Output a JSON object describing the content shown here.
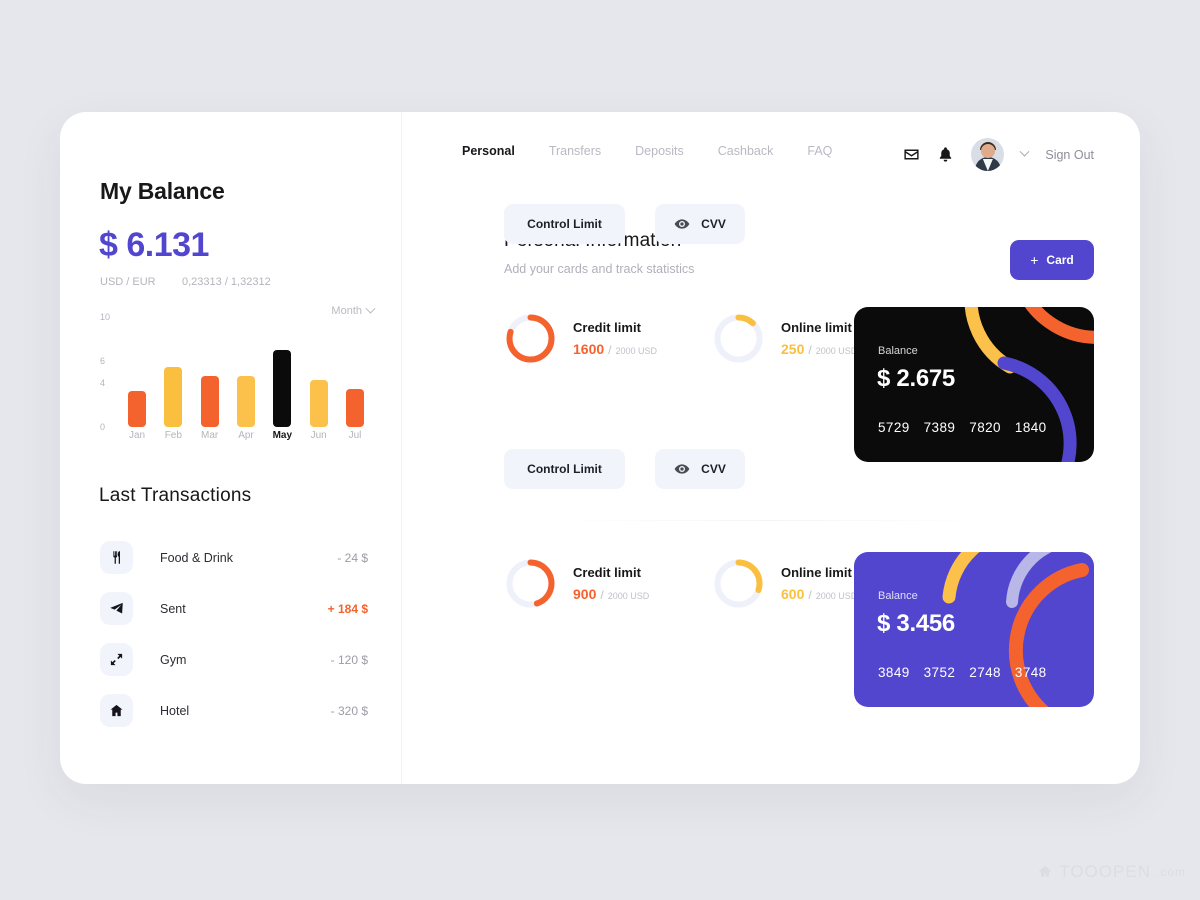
{
  "sidebar": {
    "balance_title": "My Balance",
    "balance_amount": "$ 6.131",
    "rate_label": "USD / EUR",
    "rate_value": "0,23313 / 1,32312",
    "period_selector": "Month",
    "transactions_title": "Last  Transactions",
    "transactions": [
      {
        "icon": "cutlery-icon",
        "name": "Food & Drink",
        "amount": "- 24 $",
        "positive": false
      },
      {
        "icon": "paper-plane-icon",
        "name": "Sent",
        "amount": "+ 184 $",
        "positive": true
      },
      {
        "icon": "dumbbell-icon",
        "name": "Gym",
        "amount": "- 120 $",
        "positive": false
      },
      {
        "icon": "home-icon",
        "name": "Hotel",
        "amount": "- 320 $",
        "positive": false
      }
    ]
  },
  "chart_data": {
    "type": "bar",
    "title": "",
    "xlabel": "",
    "ylabel": "",
    "categories": [
      "Jan",
      "Feb",
      "Mar",
      "Apr",
      "May",
      "Jul",
      "Jun"
    ],
    "tick_labels": [
      "Jan",
      "Feb",
      "Mar",
      "Apr",
      "May",
      "Jun",
      "Jul"
    ],
    "values": [
      3.3,
      5.5,
      4.6,
      4.6,
      7.0,
      4.3,
      3.5
    ],
    "colors": [
      "#f4632e",
      "#fbbf3f",
      "#f4632e",
      "#fbc14a",
      "#0b0b0c",
      "#fbc14a",
      "#f4632e"
    ],
    "highlighted": "May",
    "ylim": [
      0,
      10
    ],
    "yticks": [
      0,
      4,
      6,
      10
    ],
    "ytick_labels": [
      "0",
      "4",
      "6",
      "10"
    ],
    "grid": false,
    "legend": "none"
  },
  "topnav": {
    "items": [
      {
        "label": "Personal",
        "active": true
      },
      {
        "label": "Transfers",
        "active": false
      },
      {
        "label": "Deposits",
        "active": false
      },
      {
        "label": "Cashback",
        "active": false
      },
      {
        "label": "FAQ",
        "active": false
      }
    ],
    "mail_icon": "envelope-icon",
    "bell_icon": "bell-icon",
    "avatar": "user-avatar",
    "chevron": "chevron-down-icon",
    "signout": "Sign Out"
  },
  "main": {
    "title": "Personal Information",
    "subtitle": "Add your cards and track statistics",
    "add_card_button": "Card",
    "add_card_plus": "+"
  },
  "limits": [
    {
      "credit": {
        "label": "Credit limit",
        "current": "1600",
        "separator": "/",
        "max": "2000 USD",
        "percent": 80,
        "color": "#f4632e"
      },
      "online": {
        "label": "Online limit",
        "current": "250",
        "separator": "/",
        "max": "2000 USD",
        "percent": 12,
        "color": "#fbbf3f"
      },
      "buttons": {
        "control": "Control Limit",
        "cvv": "CVV",
        "cvv_icon": "eye-icon"
      }
    },
    {
      "credit": {
        "label": "Credit limit",
        "current": "900",
        "separator": "/",
        "max": "2000 USD",
        "percent": 45,
        "color": "#f4632e"
      },
      "online": {
        "label": "Online limit",
        "current": "600",
        "separator": "/",
        "max": "2000 USD",
        "percent": 30,
        "color": "#fbbf3f"
      },
      "buttons": {
        "control": "Control Limit",
        "cvv": "CVV",
        "cvv_icon": "eye-icon"
      }
    }
  ],
  "cards": [
    {
      "theme": "black",
      "background": "#0b0b0c",
      "balance_label": "Balance",
      "balance": "$ 2.675",
      "number_groups": [
        "5729",
        "7389",
        "7820",
        "1840"
      ],
      "arc_colors": [
        "#fbc14a",
        "#f4632e",
        "#5246cf"
      ]
    },
    {
      "theme": "purple",
      "background": "#5246cf",
      "balance_label": "Balance",
      "balance": "$ 3.456",
      "number_groups": [
        "3849",
        "3752",
        "2748",
        "3748"
      ],
      "arc_colors": [
        "#fbc14a",
        "#b9b6e8",
        "#f4632e"
      ]
    }
  ],
  "watermark": {
    "main": "TOOOPEN",
    "sub": ".com"
  },
  "colors": {
    "accent_purple": "#5246cf",
    "orange": "#f4632e",
    "yellow": "#fbbf3f",
    "page_bg": "#e6e7ec",
    "panel_bg": "#ffffff",
    "muted_text": "#b4b4bd"
  }
}
